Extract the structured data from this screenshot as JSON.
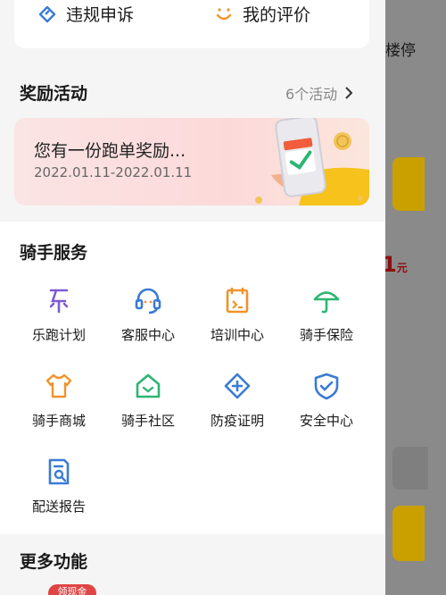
{
  "top": {
    "appeal_label": "违规申诉",
    "review_label": "我的评价"
  },
  "rewards": {
    "title": "奖励活动",
    "count_label": "6个活动",
    "banner_title": "您有一份跑单奖励...",
    "banner_date": "2022.01.11-2022.01.11"
  },
  "services": {
    "title": "骑手服务",
    "items": [
      {
        "label": "乐跑计划",
        "icon": "le-run-icon"
      },
      {
        "label": "客服中心",
        "icon": "headset-icon"
      },
      {
        "label": "培训中心",
        "icon": "training-icon"
      },
      {
        "label": "骑手保险",
        "icon": "umbrella-icon"
      },
      {
        "label": "骑手商城",
        "icon": "shirt-icon"
      },
      {
        "label": "骑手社区",
        "icon": "community-house-icon"
      },
      {
        "label": "防疫证明",
        "icon": "medical-cross-icon"
      },
      {
        "label": "安全中心",
        "icon": "shield-check-icon"
      },
      {
        "label": "配送报告",
        "icon": "report-icon"
      }
    ]
  },
  "more": {
    "title": "更多功能",
    "badge": "领现金"
  },
  "background": {
    "floor_text": "楼停",
    "price_text": "1",
    "price_unit": "元"
  },
  "colors": {
    "accent_blue": "#3a7bd5",
    "accent_purple": "#7b5bd6",
    "accent_orange": "#f0932b",
    "accent_green": "#2bb673",
    "brand_yellow": "#c9a000",
    "price_red": "#8a0f0f"
  }
}
